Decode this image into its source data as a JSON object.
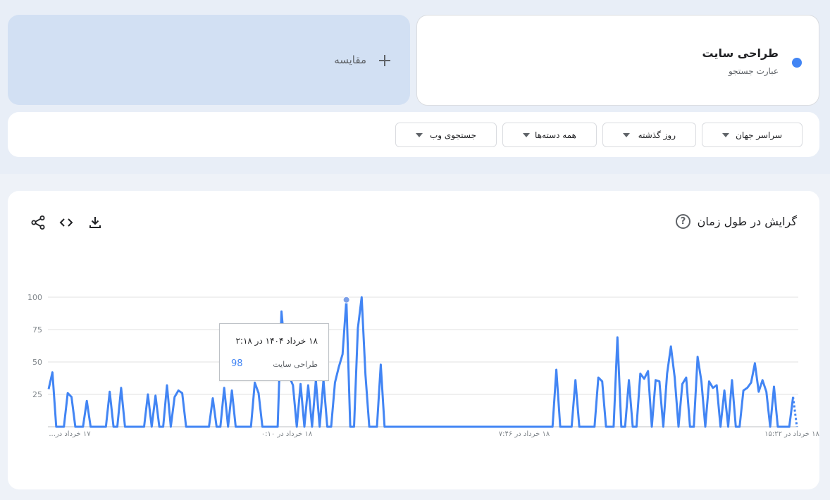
{
  "term": {
    "title": "طراحی سایت",
    "subtitle": "عبارت جستجو",
    "color": "#4285f4"
  },
  "compare": {
    "label": "مقایسه",
    "icon": "plus-icon"
  },
  "filters": [
    {
      "label": "سراسر جهان"
    },
    {
      "label": "روز گذشته"
    },
    {
      "label": "همه دسته‌ها"
    },
    {
      "label": "جستجوی وب"
    }
  ],
  "chart_card": {
    "title": "گرایش در طول زمان",
    "help_icon": "help-icon",
    "tools": [
      "download-icon",
      "embed-icon",
      "share-icon"
    ]
  },
  "tooltip": {
    "date": "۱۸ خرداد ۱۴۰۴ در ۲:۱۸",
    "term": "طراحی سایت",
    "value": "98"
  },
  "chart_data": {
    "type": "line",
    "ylim": [
      0,
      100
    ],
    "y_ticks": [
      "25",
      "50",
      "75",
      "100"
    ],
    "x_tick_labels": [
      "۱۷ خرداد در...",
      "۱۸ خرداد در ۰:۱۰",
      "۱۸ خرداد در ۷:۴۶",
      "۱۸ خرداد در ۱۵:۲۲"
    ],
    "series": [
      {
        "name": "طراحی سایت",
        "color": "#4285f4",
        "values": [
          29,
          42,
          0,
          0,
          0,
          26,
          23,
          0,
          0,
          0,
          20,
          0,
          0,
          0,
          0,
          0,
          27,
          0,
          0,
          30,
          0,
          0,
          0,
          0,
          0,
          0,
          25,
          0,
          24,
          0,
          0,
          32,
          0,
          23,
          28,
          26,
          0,
          0,
          0,
          0,
          0,
          0,
          0,
          22,
          0,
          0,
          30,
          0,
          28,
          0,
          0,
          0,
          0,
          0,
          34,
          26,
          0,
          0,
          0,
          0,
          0,
          89,
          56,
          39,
          32,
          0,
          33,
          0,
          32,
          0,
          36,
          0,
          36,
          0,
          0,
          34,
          46,
          56,
          98,
          0,
          0,
          76,
          100,
          40,
          0,
          0,
          0,
          48,
          0,
          0,
          0,
          0,
          0,
          0,
          0,
          0,
          0,
          0,
          0,
          0,
          0,
          0,
          0,
          0,
          0,
          0,
          0,
          0,
          0,
          0,
          0,
          0,
          0,
          0,
          0,
          0,
          0,
          0,
          0,
          0,
          0,
          0,
          0,
          0,
          0,
          0,
          0,
          0,
          0,
          0,
          0,
          0,
          0,
          44,
          0,
          0,
          0,
          0,
          36,
          0,
          0,
          0,
          0,
          0,
          38,
          35,
          0,
          0,
          0,
          69,
          0,
          0,
          36,
          0,
          0,
          41,
          37,
          43,
          0,
          36,
          35,
          0,
          41,
          62,
          38,
          0,
          33,
          38,
          0,
          0,
          54,
          35,
          0,
          35,
          30,
          32,
          0,
          28,
          0,
          36,
          0,
          0,
          28,
          30,
          34,
          49,
          27,
          36,
          27,
          0,
          31,
          0,
          0,
          0,
          0,
          23,
          0
        ],
        "partial_tail": [
          23,
          0
        ]
      }
    ]
  }
}
